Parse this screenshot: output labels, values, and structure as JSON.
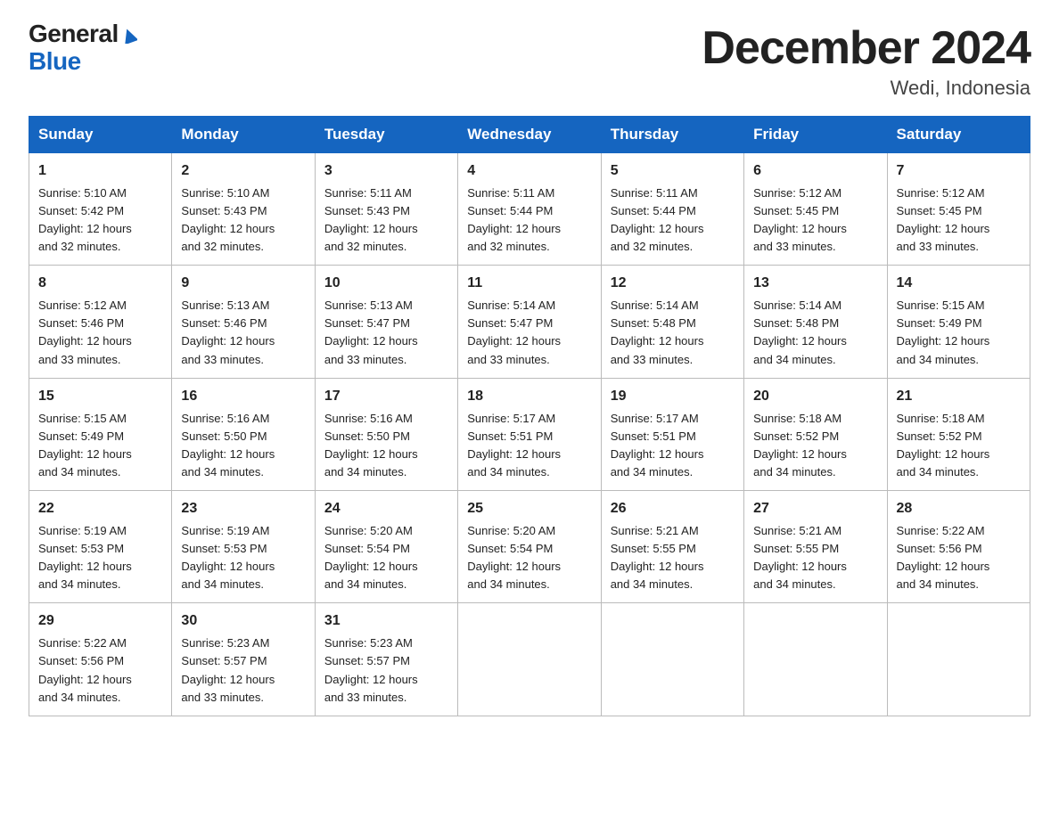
{
  "logo": {
    "general": "General",
    "blue": "Blue",
    "triangle": "▶"
  },
  "header": {
    "month_title": "December 2024",
    "subtitle": "Wedi, Indonesia"
  },
  "days_of_week": [
    "Sunday",
    "Monday",
    "Tuesday",
    "Wednesday",
    "Thursday",
    "Friday",
    "Saturday"
  ],
  "weeks": [
    [
      {
        "day": "1",
        "sunrise": "5:10 AM",
        "sunset": "5:42 PM",
        "daylight": "12 hours and 32 minutes."
      },
      {
        "day": "2",
        "sunrise": "5:10 AM",
        "sunset": "5:43 PM",
        "daylight": "12 hours and 32 minutes."
      },
      {
        "day": "3",
        "sunrise": "5:11 AM",
        "sunset": "5:43 PM",
        "daylight": "12 hours and 32 minutes."
      },
      {
        "day": "4",
        "sunrise": "5:11 AM",
        "sunset": "5:44 PM",
        "daylight": "12 hours and 32 minutes."
      },
      {
        "day": "5",
        "sunrise": "5:11 AM",
        "sunset": "5:44 PM",
        "daylight": "12 hours and 32 minutes."
      },
      {
        "day": "6",
        "sunrise": "5:12 AM",
        "sunset": "5:45 PM",
        "daylight": "12 hours and 33 minutes."
      },
      {
        "day": "7",
        "sunrise": "5:12 AM",
        "sunset": "5:45 PM",
        "daylight": "12 hours and 33 minutes."
      }
    ],
    [
      {
        "day": "8",
        "sunrise": "5:12 AM",
        "sunset": "5:46 PM",
        "daylight": "12 hours and 33 minutes."
      },
      {
        "day": "9",
        "sunrise": "5:13 AM",
        "sunset": "5:46 PM",
        "daylight": "12 hours and 33 minutes."
      },
      {
        "day": "10",
        "sunrise": "5:13 AM",
        "sunset": "5:47 PM",
        "daylight": "12 hours and 33 minutes."
      },
      {
        "day": "11",
        "sunrise": "5:14 AM",
        "sunset": "5:47 PM",
        "daylight": "12 hours and 33 minutes."
      },
      {
        "day": "12",
        "sunrise": "5:14 AM",
        "sunset": "5:48 PM",
        "daylight": "12 hours and 33 minutes."
      },
      {
        "day": "13",
        "sunrise": "5:14 AM",
        "sunset": "5:48 PM",
        "daylight": "12 hours and 34 minutes."
      },
      {
        "day": "14",
        "sunrise": "5:15 AM",
        "sunset": "5:49 PM",
        "daylight": "12 hours and 34 minutes."
      }
    ],
    [
      {
        "day": "15",
        "sunrise": "5:15 AM",
        "sunset": "5:49 PM",
        "daylight": "12 hours and 34 minutes."
      },
      {
        "day": "16",
        "sunrise": "5:16 AM",
        "sunset": "5:50 PM",
        "daylight": "12 hours and 34 minutes."
      },
      {
        "day": "17",
        "sunrise": "5:16 AM",
        "sunset": "5:50 PM",
        "daylight": "12 hours and 34 minutes."
      },
      {
        "day": "18",
        "sunrise": "5:17 AM",
        "sunset": "5:51 PM",
        "daylight": "12 hours and 34 minutes."
      },
      {
        "day": "19",
        "sunrise": "5:17 AM",
        "sunset": "5:51 PM",
        "daylight": "12 hours and 34 minutes."
      },
      {
        "day": "20",
        "sunrise": "5:18 AM",
        "sunset": "5:52 PM",
        "daylight": "12 hours and 34 minutes."
      },
      {
        "day": "21",
        "sunrise": "5:18 AM",
        "sunset": "5:52 PM",
        "daylight": "12 hours and 34 minutes."
      }
    ],
    [
      {
        "day": "22",
        "sunrise": "5:19 AM",
        "sunset": "5:53 PM",
        "daylight": "12 hours and 34 minutes."
      },
      {
        "day": "23",
        "sunrise": "5:19 AM",
        "sunset": "5:53 PM",
        "daylight": "12 hours and 34 minutes."
      },
      {
        "day": "24",
        "sunrise": "5:20 AM",
        "sunset": "5:54 PM",
        "daylight": "12 hours and 34 minutes."
      },
      {
        "day": "25",
        "sunrise": "5:20 AM",
        "sunset": "5:54 PM",
        "daylight": "12 hours and 34 minutes."
      },
      {
        "day": "26",
        "sunrise": "5:21 AM",
        "sunset": "5:55 PM",
        "daylight": "12 hours and 34 minutes."
      },
      {
        "day": "27",
        "sunrise": "5:21 AM",
        "sunset": "5:55 PM",
        "daylight": "12 hours and 34 minutes."
      },
      {
        "day": "28",
        "sunrise": "5:22 AM",
        "sunset": "5:56 PM",
        "daylight": "12 hours and 34 minutes."
      }
    ],
    [
      {
        "day": "29",
        "sunrise": "5:22 AM",
        "sunset": "5:56 PM",
        "daylight": "12 hours and 34 minutes."
      },
      {
        "day": "30",
        "sunrise": "5:23 AM",
        "sunset": "5:57 PM",
        "daylight": "12 hours and 33 minutes."
      },
      {
        "day": "31",
        "sunrise": "5:23 AM",
        "sunset": "5:57 PM",
        "daylight": "12 hours and 33 minutes."
      },
      null,
      null,
      null,
      null
    ]
  ],
  "labels": {
    "sunrise": "Sunrise:",
    "sunset": "Sunset:",
    "daylight": "Daylight:"
  }
}
